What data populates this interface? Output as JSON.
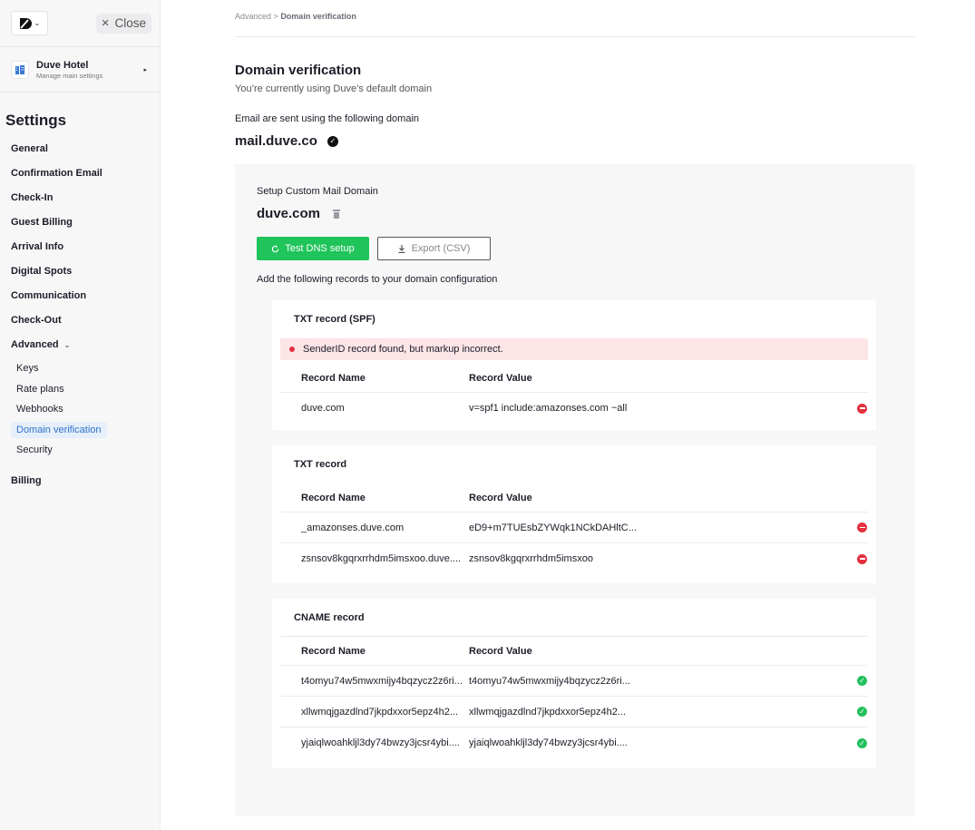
{
  "sidebar": {
    "close_label": "Close",
    "hotel_name": "Duve Hotel",
    "hotel_subtitle": "Manage main settings",
    "settings_title": "Settings",
    "items": [
      {
        "label": "General"
      },
      {
        "label": "Confirmation Email"
      },
      {
        "label": "Check-In"
      },
      {
        "label": "Guest Billing"
      },
      {
        "label": "Arrival Info"
      },
      {
        "label": "Digital Spots"
      },
      {
        "label": "Communication"
      },
      {
        "label": "Check-Out"
      },
      {
        "label": "Advanced"
      },
      {
        "label": "Billing"
      }
    ],
    "advanced_sub": [
      {
        "label": "Keys"
      },
      {
        "label": "Rate plans"
      },
      {
        "label": "Webhooks"
      },
      {
        "label": "Domain verification"
      },
      {
        "label": "Security"
      }
    ]
  },
  "breadcrumb": {
    "parent": "Advanced >",
    "current": "Domain verification"
  },
  "page": {
    "title": "Domain verification",
    "subtitle": "You’re currently using Duve’s default domain",
    "email_label": "Email are sent using the following domain",
    "current_domain": "mail.duve.co"
  },
  "setup": {
    "label": "Setup Custom Mail Domain",
    "domain": "duve.com",
    "test_button": "Test DNS setup",
    "export_button": "Export (CSV)",
    "instruction": "Add the following records to your domain configuration"
  },
  "records": {
    "col_name": "Record Name",
    "col_value": "Record Value",
    "spf": {
      "title": "TXT record (SPF)",
      "alert": "SenderID record found, but markup incorrect.",
      "rows": [
        {
          "name": "duve.com",
          "value": "v=spf1 include:amazonses.com ~all",
          "status": "error"
        }
      ]
    },
    "txt": {
      "title": "TXT record",
      "rows": [
        {
          "name": "_amazonses.duve.com",
          "value": "eD9+m7TUEsbZYWqk1NCkDAHltC...",
          "status": "error"
        },
        {
          "name": "zsnsov8kgqrxrrhdm5imsxoo.duve....",
          "value": "zsnsov8kgqrxrrhdm5imsxoo",
          "status": "error"
        }
      ]
    },
    "cname": {
      "title": "CNAME record",
      "rows": [
        {
          "name": "t4omyu74w5mwxmijy4bqzycz2z6ri...",
          "value": "t4omyu74w5mwxmijy4bqzycz2z6ri...",
          "status": "ok"
        },
        {
          "name": "xllwmqjgazdlnd7jkpdxxor5epz4h2...",
          "value": "xllwmqjgazdlnd7jkpdxxor5epz4h2...",
          "status": "ok"
        },
        {
          "name": "yjaiqlwoahkljl3dy74bwzy3jcsr4ybi....",
          "value": "yjaiqlwoahkljl3dy74bwzy3jcsr4ybi....",
          "status": "ok"
        }
      ]
    }
  },
  "colors": {
    "accent": "#1fc45a",
    "error": "#e5303f",
    "active_nav": "#2f73c8"
  }
}
